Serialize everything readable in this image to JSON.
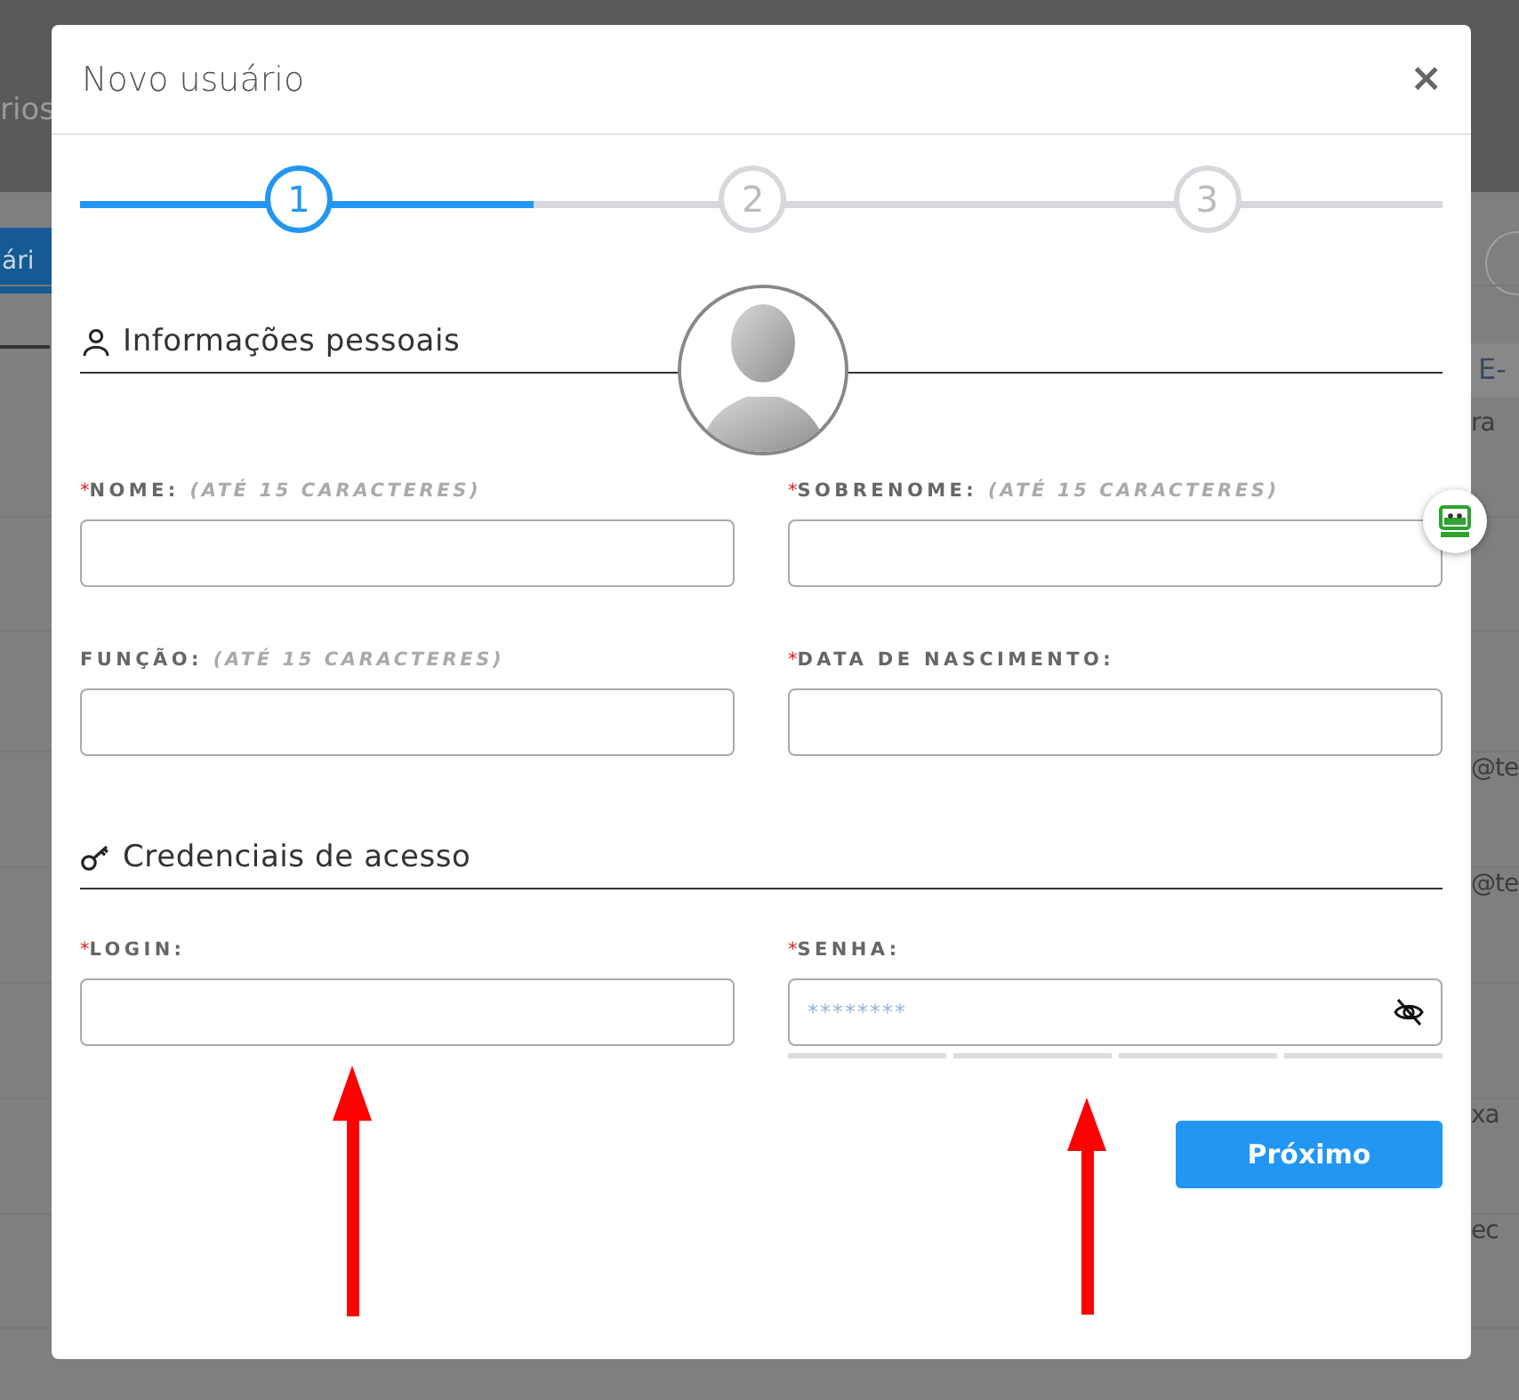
{
  "background": {
    "nav_text": "rios",
    "button": "ári",
    "column_header": "E-",
    "cells": [
      "ra",
      "@te",
      "@te",
      "xa",
      "ec"
    ]
  },
  "modal": {
    "title": "Novo usuário",
    "close": "×",
    "steps": [
      {
        "label": "1",
        "selected": true
      },
      {
        "label": "2",
        "selected": false
      },
      {
        "label": "3",
        "selected": false
      }
    ],
    "sections": [
      {
        "kind": "personal",
        "title": "Informações pessoais",
        "fields": [
          {
            "label": "NOME:",
            "hint": "(ATÉ 15 CARACTERES)",
            "required_mark": "*",
            "kind": "text"
          },
          {
            "label": "SOBRENOME:",
            "hint": "(ATÉ 15 CARACTERES)",
            "required_mark": "*",
            "kind": "text"
          },
          {
            "label": "FUNÇÃO:",
            "hint": "(ATÉ 15 CARACTERES)",
            "kind": "text"
          },
          {
            "label": "DATA DE NASCIMENTO:",
            "required_mark": "*",
            "kind": "text"
          }
        ]
      },
      {
        "kind": "credentials",
        "title": "Credenciais de acesso",
        "fields": [
          {
            "label": "LOGIN:",
            "required_mark": "*",
            "kind": "text"
          },
          {
            "label": "SENHA:",
            "required_mark": "*",
            "kind": "password",
            "placeholder": "********"
          }
        ]
      }
    ],
    "next_button": "Próximo"
  }
}
